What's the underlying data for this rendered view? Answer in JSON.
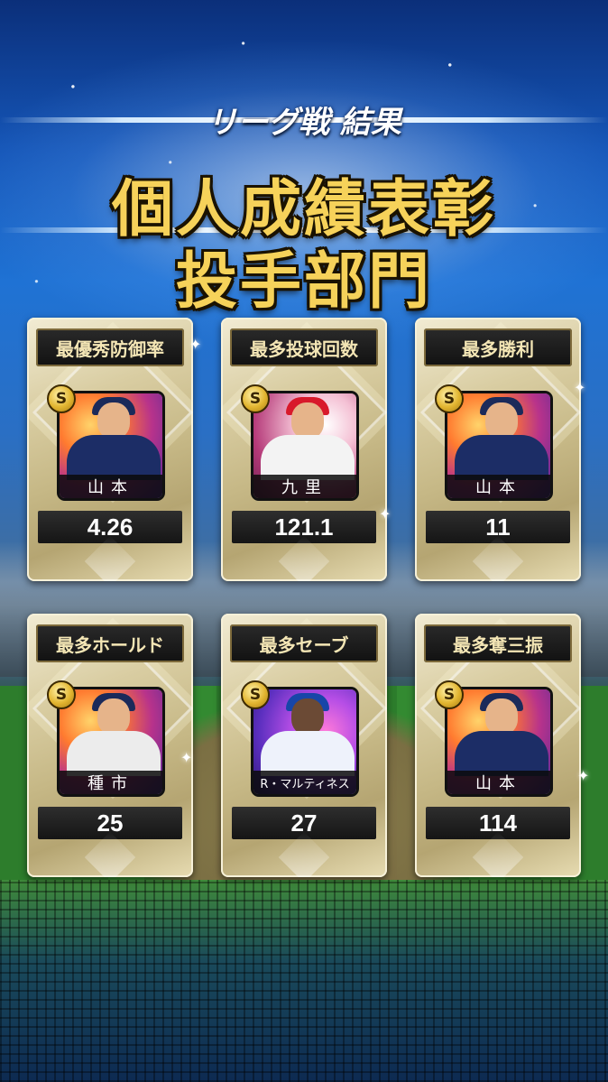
{
  "header": {
    "subtitle": "リーグ戦 結果",
    "title_line1": "個人成績表彰",
    "title_line2": "投手部門"
  },
  "awards": [
    {
      "category": "最優秀防御率",
      "player": "山本",
      "value": "4.26",
      "rank_badge": "S",
      "portrait_icon": "player-portrait-icon"
    },
    {
      "category": "最多投球回数",
      "player": "九里",
      "value": "121.1",
      "rank_badge": "S",
      "portrait_icon": "player-portrait-icon"
    },
    {
      "category": "最多勝利",
      "player": "山本",
      "value": "11",
      "rank_badge": "S",
      "portrait_icon": "player-portrait-icon"
    },
    {
      "category": "最多ホールド",
      "player": "種市",
      "value": "25",
      "rank_badge": "S",
      "portrait_icon": "player-portrait-icon"
    },
    {
      "category": "最多セーブ",
      "player": "R・マルティネス",
      "value": "27",
      "rank_badge": "S",
      "portrait_icon": "player-portrait-icon"
    },
    {
      "category": "最多奪三振",
      "player": "山本",
      "value": "114",
      "rank_badge": "S",
      "portrait_icon": "player-portrait-icon"
    }
  ],
  "colors": {
    "title_gold": "#f6d25a",
    "card_gold": "#c6b886",
    "label_bg": "#111111"
  }
}
